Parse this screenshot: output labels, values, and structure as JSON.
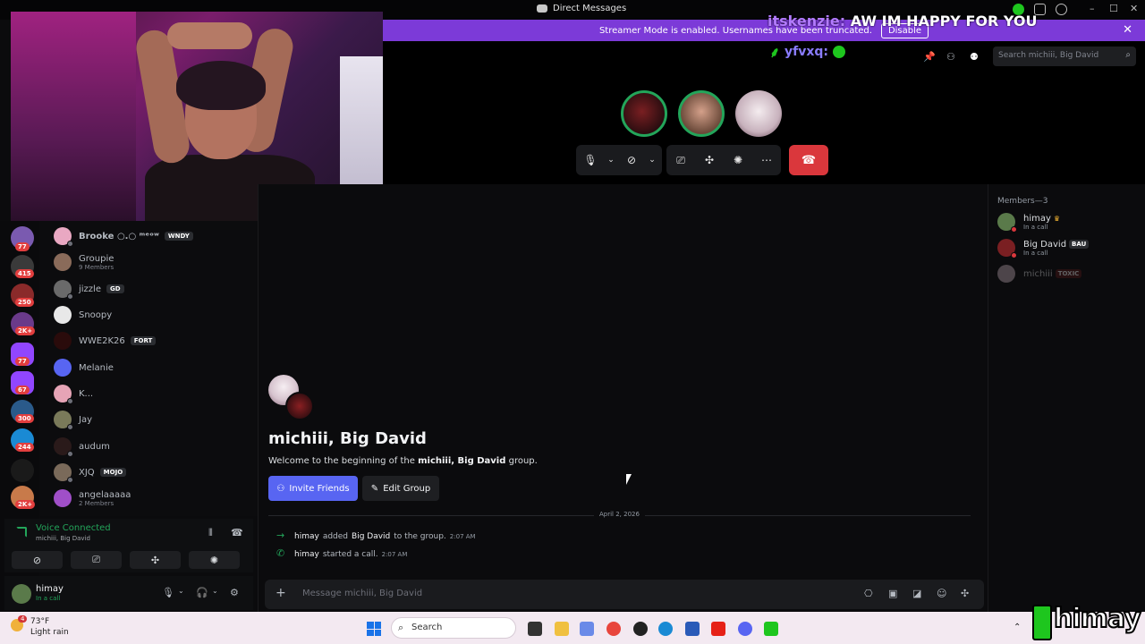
{
  "titlebar": {
    "title": "Direct Messages"
  },
  "banner": {
    "text": "Streamer Mode is enabled. Usernames have been truncated.",
    "disable_label": "Disable"
  },
  "chat_overlay": {
    "line1_user": "itskenzie:",
    "line1_msg": "AW IM HAPPY FOR YOU",
    "line2_user": "yfvxq:"
  },
  "rail": {
    "badges": [
      "77",
      "415",
      "250",
      "2K+",
      "77",
      "67",
      "300",
      "244",
      "2K+"
    ]
  },
  "dms": [
    {
      "name": "Brooke ○.○ ᵐᵉᵒʷ",
      "tag": "WNDY",
      "sub": "",
      "color": "#e9a8c2"
    },
    {
      "name": "Groupie",
      "tag": "",
      "sub": "9 Members",
      "color": "#8a6b5a"
    },
    {
      "name": "jizzle",
      "tag": "GD",
      "sub": "",
      "color": "#6a6a6a"
    },
    {
      "name": "Snoopy",
      "tag": "",
      "sub": "",
      "color": "#e8e8e8"
    },
    {
      "name": "WWE2K26",
      "tag": "FORT",
      "sub": "",
      "color": "#2a0b0b"
    },
    {
      "name": "Melanie",
      "tag": "",
      "sub": "",
      "color": "#5865f2"
    },
    {
      "name": "K...",
      "tag": "",
      "sub": "",
      "color": "#e6a4b6"
    },
    {
      "name": "Jay",
      "tag": "",
      "sub": "",
      "color": "#7a7a5a"
    },
    {
      "name": "audum",
      "tag": "",
      "sub": "",
      "color": "#2a1a1a"
    },
    {
      "name": "XJQ",
      "tag": "MOJO",
      "sub": "",
      "color": "#7a6a5a"
    },
    {
      "name": "angelaaaaa",
      "tag": "",
      "sub": "2 Members",
      "color": "#a04fc8"
    }
  ],
  "voice": {
    "status": "Voice Connected",
    "channel": "michiii, Big David"
  },
  "user": {
    "name": "himay",
    "status": "In a call"
  },
  "header": {
    "search_placeholder": "Search michiii, Big David"
  },
  "group": {
    "title": "michiii, Big David",
    "welcome_prefix": "Welcome to the beginning of the",
    "welcome_name": "michiii, Big David",
    "welcome_suffix": "group.",
    "invite_label": "Invite Friends",
    "edit_label": "Edit Group",
    "date": "April 2, 2026"
  },
  "messages": [
    {
      "actor": "himay",
      "action": "added",
      "target": "Big David",
      "rest": "to the group.",
      "time": "2:07 AM"
    },
    {
      "actor": "himay",
      "action": "started a call.",
      "target": "",
      "rest": "",
      "time": "2:07 AM"
    }
  ],
  "composer": {
    "placeholder": "Message michiii, Big David"
  },
  "members": {
    "header": "Members—3",
    "list": [
      {
        "name": "himay",
        "crown": "♛",
        "tag": "",
        "sub": "In a call"
      },
      {
        "name": "Big David",
        "crown": "",
        "tag": "BAU",
        "sub": "In a call"
      },
      {
        "name": "michiii",
        "crown": "",
        "tag": "TOXIC",
        "sub": ""
      }
    ]
  },
  "taskbar": {
    "temp": "73°F",
    "condition": "Light rain",
    "weather_badge": "4",
    "search_label": "Search"
  },
  "logo": {
    "text": "himay"
  }
}
